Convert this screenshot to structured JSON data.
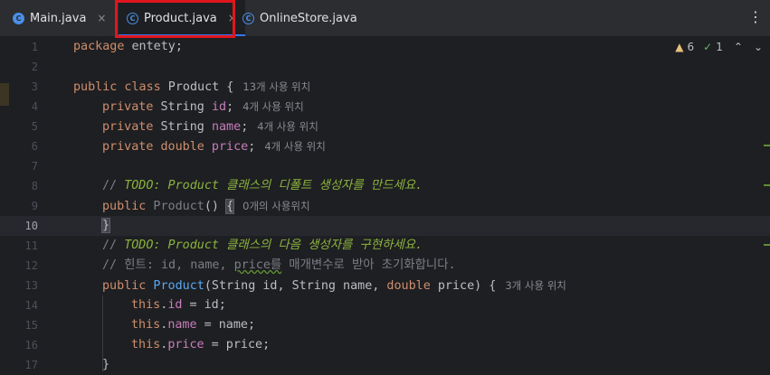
{
  "tabs": [
    {
      "label": "Main.java",
      "icon": "run-class-icon",
      "close": "×"
    },
    {
      "label": "Product.java",
      "icon": "class-icon",
      "close": "×",
      "active": true
    },
    {
      "label": "OnlineStore.java",
      "icon": "class-icon",
      "close": ""
    }
  ],
  "tab_icon_letter": "C",
  "more_icon": "⋮",
  "inspections": {
    "warnings": "6",
    "weak_warnings": "1",
    "warn_icon": "▲",
    "ok_icon": "✓",
    "up": "⌃",
    "down": "⌄"
  },
  "lines": [
    {
      "n": "1"
    },
    {
      "n": "2"
    },
    {
      "n": "3"
    },
    {
      "n": "4"
    },
    {
      "n": "5"
    },
    {
      "n": "6"
    },
    {
      "n": "7"
    },
    {
      "n": "8"
    },
    {
      "n": "9"
    },
    {
      "n": "10"
    },
    {
      "n": "11"
    },
    {
      "n": "12"
    },
    {
      "n": "13"
    },
    {
      "n": "14"
    },
    {
      "n": "15"
    },
    {
      "n": "16"
    },
    {
      "n": "17"
    }
  ],
  "code": {
    "l1": {
      "kw": "package",
      "rest": " entety;"
    },
    "l3": {
      "kw": "public class",
      "name": " Product {",
      "hint": "13개 사용 위치"
    },
    "l4": {
      "kw": "private",
      "type": " String ",
      "field": "id",
      "semi": ";",
      "hint": "4개 사용 위치"
    },
    "l5": {
      "kw": "private",
      "type": " String ",
      "field": "name",
      "semi": ";",
      "hint": "4개 사용 위치"
    },
    "l6": {
      "kw": "private double",
      "field": " price",
      "semi": ";",
      "hint": "4개 사용 위치"
    },
    "l8": {
      "slashes": "// ",
      "todo": "TODO: Product 클래스의 디폴트 생성자를 만드세요."
    },
    "l9": {
      "kw": "public",
      "name": " Product",
      "paren": "() ",
      "brace": "{",
      "hint": "0개의 사용위치"
    },
    "l10": {
      "brace": "}"
    },
    "l11": {
      "slashes": "// ",
      "todo": "TODO: Product 클래스의 다음 생성자를 구현하세요."
    },
    "l12": {
      "a": "// 힌트: id, name, ",
      "b": "price를",
      "c": " 매개변수로 받아 초기화합니다."
    },
    "l13": {
      "kw": "public",
      "name": " Product",
      "p1": "(String id, String name, ",
      "kw2": "double",
      "p2": " price) {",
      "hint": "3개 사용 위치"
    },
    "l14": {
      "kw": "this",
      "dot": ".",
      "field": "id",
      "rest": " = id;"
    },
    "l15": {
      "kw": "this",
      "dot": ".",
      "field": "name",
      "rest": " = name;"
    },
    "l16": {
      "kw": "this",
      "dot": ".",
      "field": "price",
      "rest": " = price;"
    },
    "l17": {
      "brace": "}"
    }
  }
}
